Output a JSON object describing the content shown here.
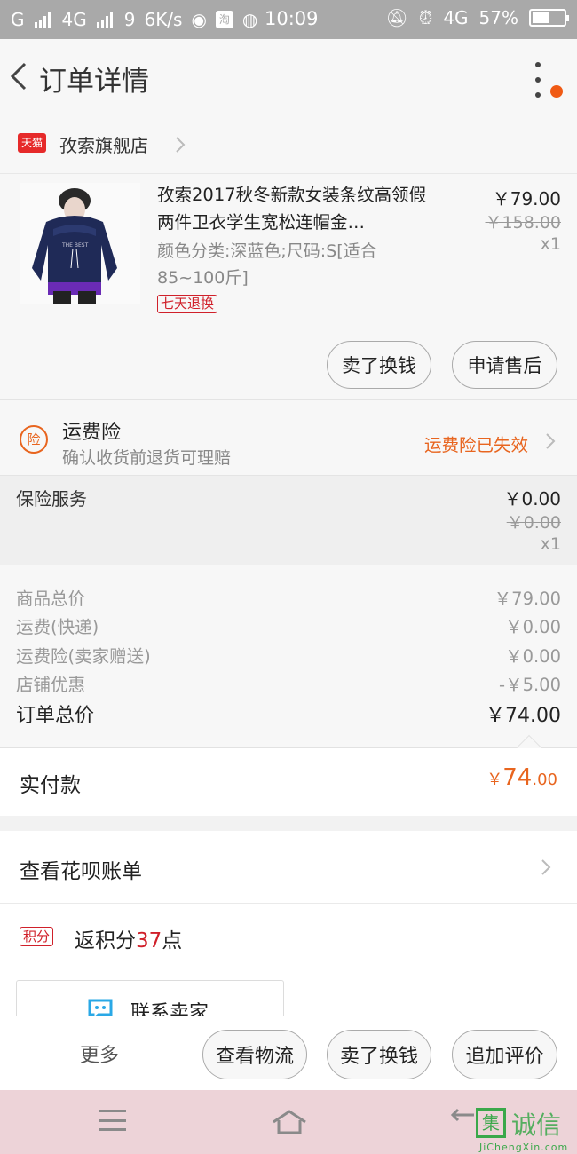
{
  "status_bar": {
    "signal_left": "G",
    "network": "4G",
    "notif_count": "9",
    "speed": "6K/s",
    "time": "10:09",
    "network_right": "4G",
    "battery": "57%",
    "battery_level": 0.57
  },
  "header": {
    "title": "订单详情"
  },
  "shop": {
    "badge": "天猫",
    "name": "孜索旗舰店"
  },
  "product": {
    "title": "孜索2017秋冬新款女装条纹高领假两件卫衣学生宽松连帽金…",
    "spec": "颜色分类:深蓝色;尺码:S[适合85~100斤]",
    "badge": "七天退换",
    "price": "￥79.00",
    "original_price": "￥158.00",
    "quantity": "x1",
    "btn_sell": "卖了换钱",
    "btn_aftersale": "申请售后"
  },
  "freight_insurance": {
    "icon_label": "险",
    "title": "运费险",
    "subtitle": "确认收货前退货可理赔",
    "status": "运费险已失效"
  },
  "insurance_service": {
    "label": "保险服务",
    "price": "￥0.00",
    "original_price": "￥0.00",
    "quantity": "x1"
  },
  "totals": {
    "rows": [
      {
        "label": "商品总价",
        "value": "￥79.00"
      },
      {
        "label": "运费(快递)",
        "value": "￥0.00"
      },
      {
        "label": "运费险(卖家赠送)",
        "value": "￥0.00"
      },
      {
        "label": "店铺优惠",
        "value": "-￥5.00"
      }
    ],
    "grand_label": "订单总价",
    "grand_value": "￥74.00"
  },
  "payment": {
    "label": "实付款",
    "currency": "￥",
    "amount_int": "74",
    "amount_dec": ".00"
  },
  "huabei": {
    "label": "查看花呗账单"
  },
  "points": {
    "badge": "积分",
    "prefix": "返积分",
    "value": "37",
    "suffix": "点"
  },
  "contact": {
    "label": "联系卖家"
  },
  "action_bar": {
    "more": "更多",
    "btn_logistics": "查看物流",
    "btn_sell": "卖了换钱",
    "btn_review": "追加评价"
  },
  "watermark": {
    "char": "集",
    "text": "诚信",
    "url": "JiChengXin.com"
  },
  "colors": {
    "accent": "#e8651f",
    "tmall_red": "#e62a2a",
    "badge_red": "#d0202a"
  }
}
